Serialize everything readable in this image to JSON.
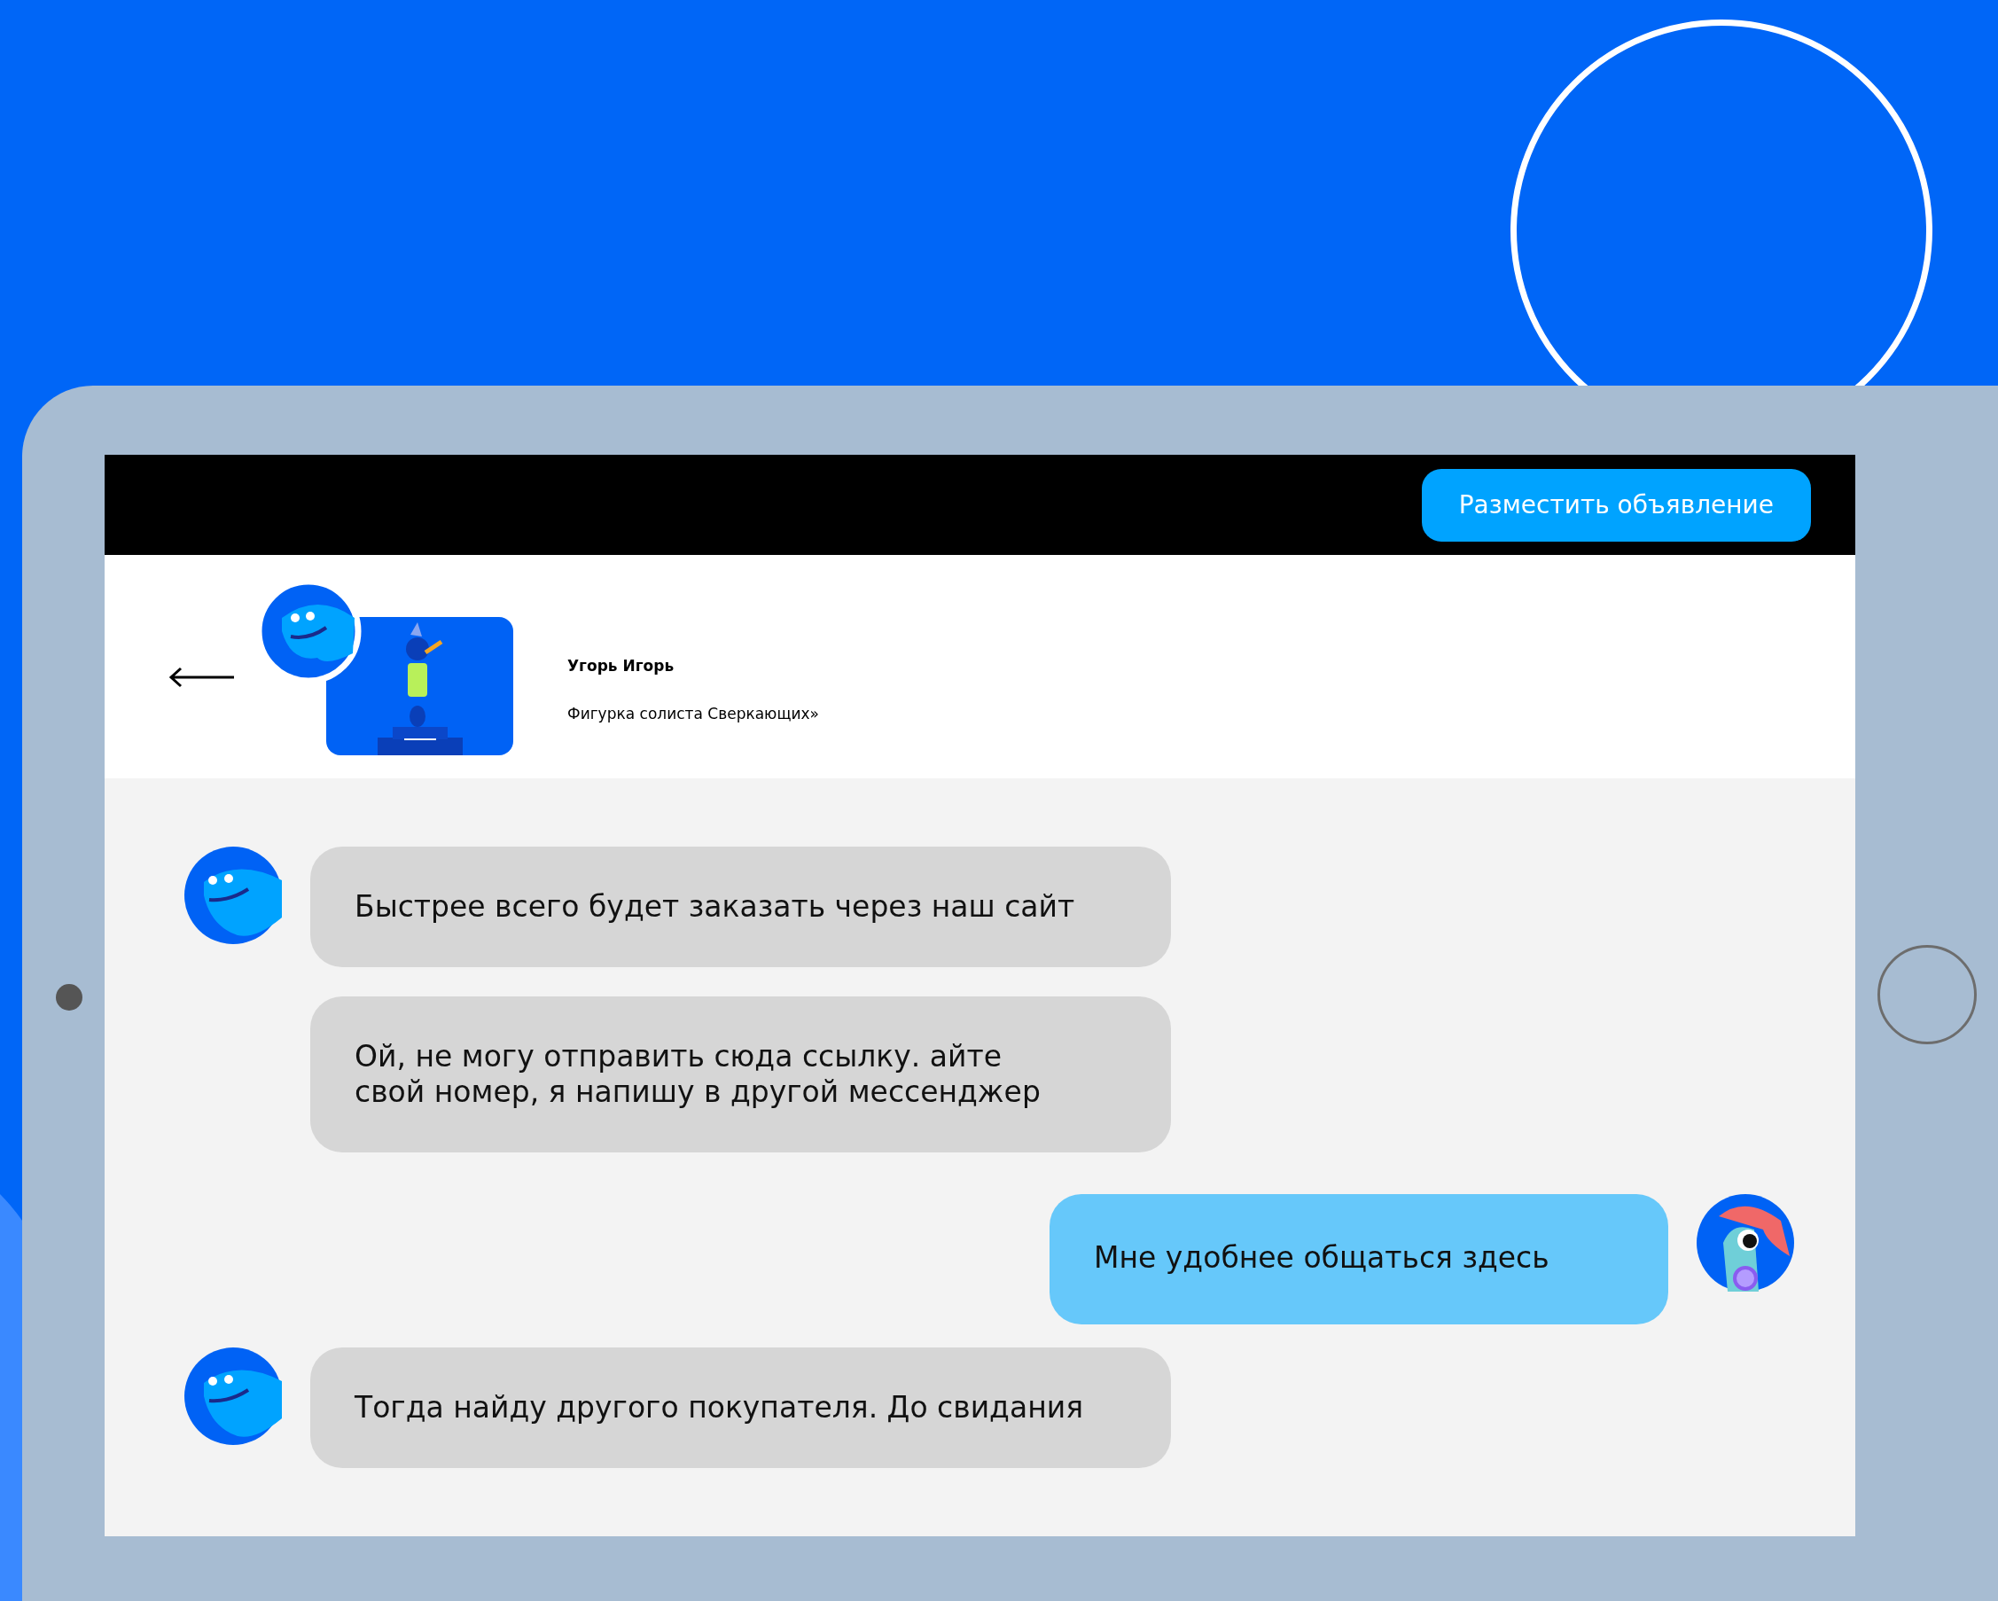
{
  "header": {
    "button": "Разместить объявление"
  },
  "listing": {
    "seller": "Угорь Игорь",
    "title": "Фигурка солиста Сверкающих»"
  },
  "messages": [
    {
      "kind": "received",
      "text": "Быстрее всего будет заказать через наш сайт",
      "avatar": true
    },
    {
      "kind": "received",
      "text": "Ой, не могу отправить сюда ссылку. айте\nсвой номер, я напишу в другой мессенджер",
      "avatar": false
    },
    {
      "kind": "sent",
      "text": "Мне удобнее общаться здесь",
      "avatar": true
    },
    {
      "kind": "received",
      "text": "Тогда найду другого покупателя. До свидания",
      "avatar": true
    }
  ]
}
